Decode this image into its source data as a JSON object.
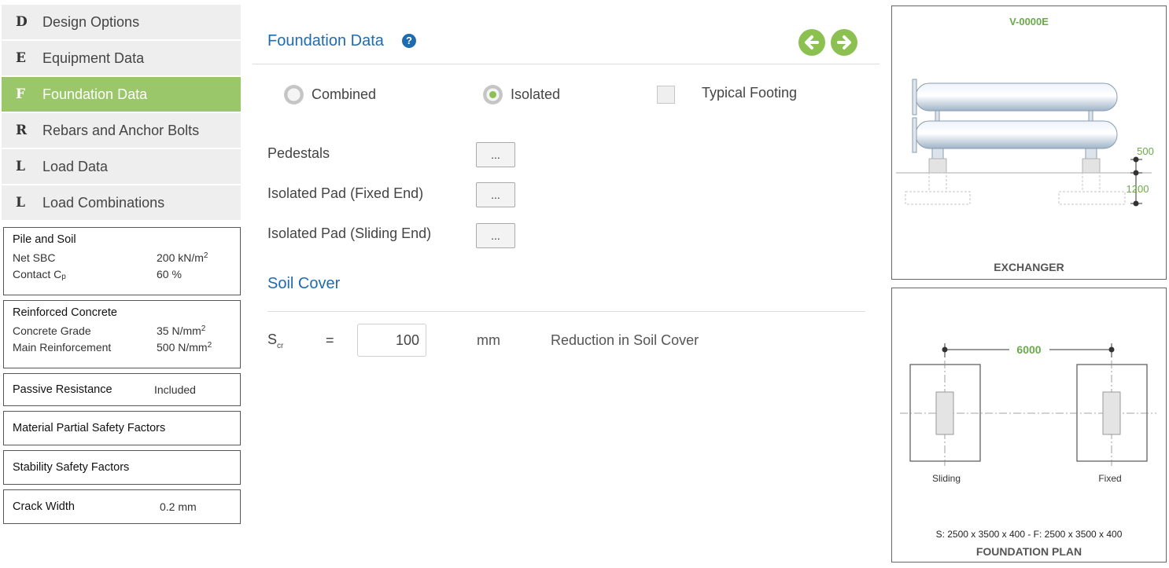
{
  "nav": [
    {
      "letter": "D",
      "label": "Design Options"
    },
    {
      "letter": "E",
      "label": "Equipment Data"
    },
    {
      "letter": "F",
      "label": "Foundation Data",
      "active": true
    },
    {
      "letter": "R",
      "label": "Rebars and Anchor Bolts"
    },
    {
      "letter": "L",
      "label": "Load Data"
    },
    {
      "letter": "L",
      "label": "Load Combinations"
    }
  ],
  "panels": {
    "pile_soil": {
      "title": "Pile and Soil",
      "net_sbc_label": "Net SBC",
      "net_sbc_value": "200 kN/m",
      "net_sbc_exp": "2",
      "contact_label": "Contact C",
      "contact_sub": "p",
      "contact_value": "60 %"
    },
    "concrete": {
      "title": "Reinforced Concrete",
      "grade_label": "Concrete Grade",
      "grade_value": "35 N/mm",
      "grade_exp": "2",
      "main_label": "Main Reinforcement",
      "main_value": "500 N/mm",
      "main_exp": "2"
    },
    "passive": {
      "title": "Passive Resistance",
      "value": "Included"
    },
    "material": {
      "title": "Material Partial Safety Factors"
    },
    "stability": {
      "title": "Stability Safety Factors"
    },
    "crack": {
      "title": "Crack Width",
      "value": "0.2 mm"
    }
  },
  "main": {
    "title": "Foundation Data",
    "help_icon": "?",
    "options": {
      "combined": "Combined",
      "isolated": "Isolated",
      "typical": "Typical Footing",
      "selected": "isolated",
      "typical_checked": false
    },
    "rows": [
      {
        "label": "Pedestals",
        "button": "..."
      },
      {
        "label": "Isolated Pad (Fixed End)",
        "button": "..."
      },
      {
        "label": "Isolated Pad (Sliding End)",
        "button": "..."
      }
    ],
    "soil_cover": {
      "title": "Soil Cover",
      "symbol": "S",
      "symbol_sub": "cr",
      "equals": "=",
      "value": "100",
      "unit": "mm",
      "description": "Reduction in Soil Cover"
    }
  },
  "diagram_top": {
    "tag": "V-0000E",
    "dim1": "500",
    "dim2": "1200",
    "caption": "EXCHANGER"
  },
  "diagram_bottom": {
    "dim": "6000",
    "left_label": "Sliding",
    "right_label": "Fixed",
    "summary": "S: 2500 x 3500 x 400 - F: 2500 x 3500 x 400",
    "caption": "FOUNDATION PLAN"
  },
  "colors": {
    "accent_green": "#9bc76b",
    "title_blue": "#1f6bb0",
    "dim_green": "#6aaa4a"
  }
}
